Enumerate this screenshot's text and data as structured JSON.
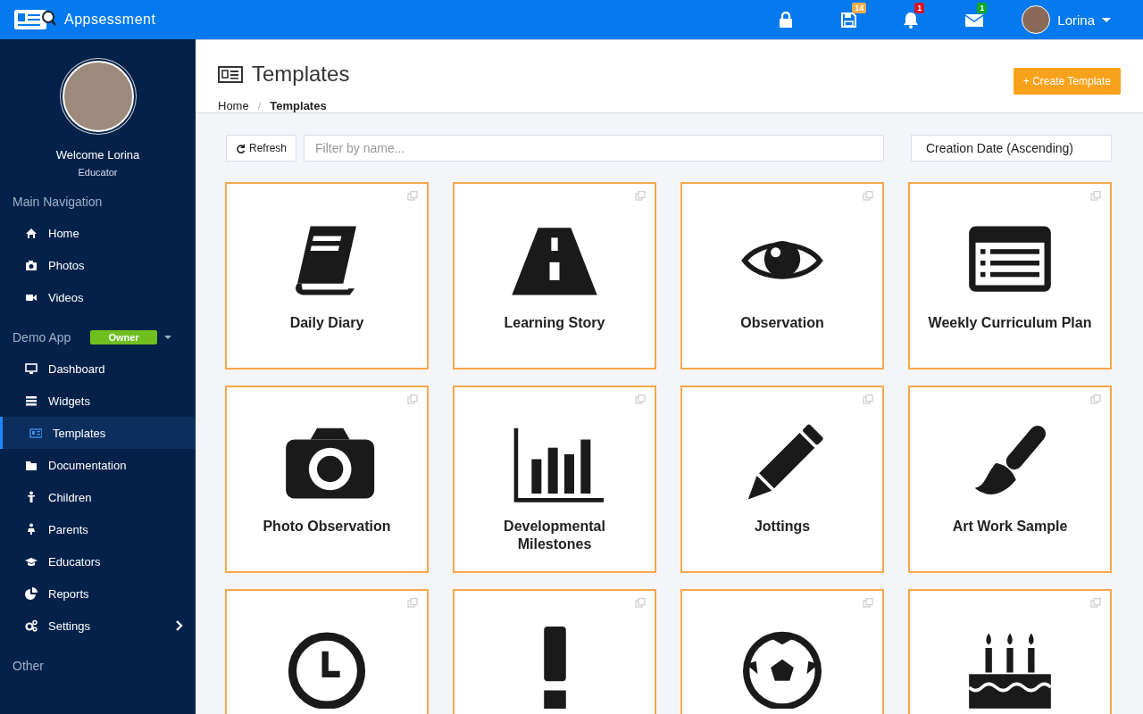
{
  "topbar": {
    "brand": "Appsessment",
    "indicators": [
      {
        "kind": "lock"
      },
      {
        "kind": "save",
        "badge": "14",
        "color": "#f0ad4e"
      },
      {
        "kind": "bell",
        "badge": "1",
        "color": "#dd1122"
      },
      {
        "kind": "mail",
        "badge": "1",
        "color": "#11aa22"
      }
    ],
    "user": "Lorina"
  },
  "sidebar": {
    "welcome": "Welcome Lorina",
    "role": "Educator",
    "sections": [
      {
        "title": "Main Navigation",
        "items": [
          {
            "label": "Home",
            "kind": "home",
            "selected": false
          },
          {
            "label": "Photos",
            "kind": "camera",
            "selected": false
          },
          {
            "label": "Videos",
            "kind": "video",
            "selected": false
          }
        ]
      },
      {
        "title": "Demo App",
        "badge": "Owner",
        "items": [
          {
            "label": "Dashboard",
            "kind": "monitor",
            "selected": false
          },
          {
            "label": "Widgets",
            "kind": "widgets",
            "selected": false
          },
          {
            "label": "Templates",
            "kind": "templates",
            "selected": true
          },
          {
            "label": "Documentation",
            "kind": "folder",
            "selected": false
          },
          {
            "label": "Children",
            "kind": "child",
            "selected": false
          },
          {
            "label": "Parents",
            "kind": "parent",
            "selected": false
          },
          {
            "label": "Educators",
            "kind": "cap",
            "selected": false
          },
          {
            "label": "Reports",
            "kind": "pie",
            "selected": false
          },
          {
            "label": "Settings",
            "kind": "gears",
            "selected": false,
            "expandable": true
          }
        ]
      },
      {
        "title": "Other"
      }
    ]
  },
  "header": {
    "title": "Templates",
    "breadcrumb": [
      "Home",
      "Templates"
    ],
    "breadcrumb_separator": "/",
    "create_button": "+ Create Template"
  },
  "toolbar": {
    "refresh": "Refresh",
    "filter_placeholder": "Filter by name...",
    "sort": "Creation Date (Ascending)"
  },
  "cards": [
    {
      "kind": "book",
      "title": "Daily Diary"
    },
    {
      "kind": "road",
      "title": "Learning Story"
    },
    {
      "kind": "eye",
      "title": "Observation"
    },
    {
      "kind": "list",
      "title": "Weekly Curriculum Plan"
    },
    {
      "kind": "camera",
      "title": "Photo Observation"
    },
    {
      "kind": "chart",
      "title": "Developmental Milestones"
    },
    {
      "kind": "pencil",
      "title": "Jottings"
    },
    {
      "kind": "brush",
      "title": "Art Work Sample"
    },
    {
      "kind": "clock"
    },
    {
      "kind": "exclamation"
    },
    {
      "kind": "ball"
    },
    {
      "kind": "cake"
    }
  ]
}
